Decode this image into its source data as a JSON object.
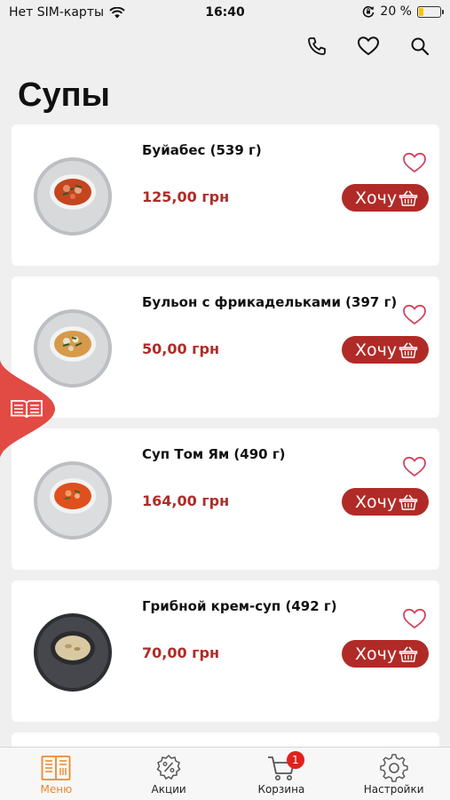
{
  "status_bar": {
    "carrier": "Нет SIM-карты",
    "time": "16:40",
    "battery": "20 %",
    "battery_level": 0.2
  },
  "header": {
    "icons": [
      "phone-icon",
      "heart-icon",
      "search-icon"
    ]
  },
  "page_title": "Супы",
  "colors": {
    "accent": "#b02b27",
    "tab_active": "#e88a2e",
    "side_tab": "#e24a44",
    "badge": "#e0221c"
  },
  "products": [
    {
      "name": "Буйабес (539 г)",
      "price": "125,00 грн",
      "button": "Хочу"
    },
    {
      "name": "Бульон с фрикадельками (397 г)",
      "price": "50,00 грн",
      "button": "Хочу"
    },
    {
      "name": "Суп Том Ям (490 г)",
      "price": "164,00 грн",
      "button": "Хочу"
    },
    {
      "name": "Грибной крем-суп (492 г)",
      "price": "70,00 грн",
      "button": "Хочу"
    }
  ],
  "tabbar": {
    "tabs": [
      {
        "label": "Меню",
        "icon": "menu-book-icon",
        "active": true
      },
      {
        "label": "Акции",
        "icon": "discount-gear-icon",
        "active": false
      },
      {
        "label": "Корзина",
        "icon": "cart-icon",
        "active": false,
        "badge": "1"
      },
      {
        "label": "Настройки",
        "icon": "settings-gear-icon",
        "active": false
      }
    ]
  }
}
